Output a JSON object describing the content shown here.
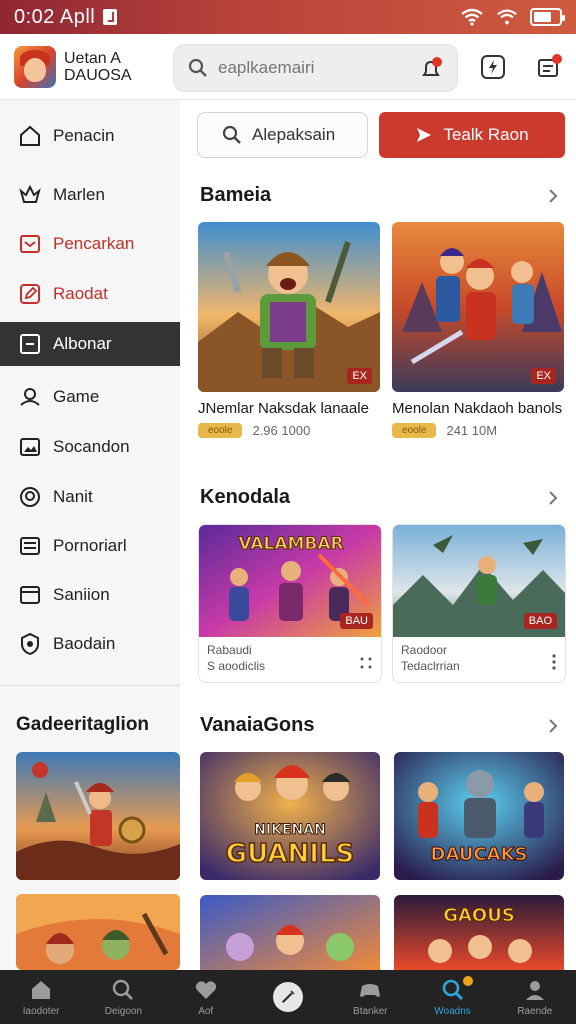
{
  "status": {
    "time": "0:02 Apll",
    "battery_level": 0.7
  },
  "header": {
    "app_name_line1": "Uetan  A",
    "app_name_line2": "DAUOSA",
    "search_placeholder": "eaplkaemairi"
  },
  "sidebar": {
    "items": [
      {
        "label": "Penacin",
        "icon": "home-icon"
      },
      {
        "label": "Marlen",
        "icon": "crown-icon"
      },
      {
        "label": "Pencarkan",
        "icon": "inbox-icon"
      },
      {
        "label": "Raodat",
        "icon": "edit-icon"
      },
      {
        "label": "Albonar",
        "icon": "square-icon"
      },
      {
        "label": "Game",
        "icon": "people-icon"
      },
      {
        "label": "Socandon",
        "icon": "image-icon"
      },
      {
        "label": "Nanit",
        "icon": "badge-icon"
      },
      {
        "label": "Pornoriarl",
        "icon": "list-icon"
      },
      {
        "label": "Saniion",
        "icon": "window-icon"
      },
      {
        "label": "Baodain",
        "icon": "shield-icon"
      }
    ],
    "section_title": "Gadeeritaglion"
  },
  "main": {
    "search_button_label": "Alepaksain",
    "cta_label": "Tealk Raon",
    "sections": [
      {
        "title": "Bameia",
        "cards": [
          {
            "title": "JNemlar Naksdak lanaale",
            "pill": "eoole",
            "meta": "2.96 1000",
            "tag": "EX"
          },
          {
            "title": "Menolan Nakdaoh banols",
            "pill": "eoole",
            "meta": "241 10M",
            "tag": "EX"
          }
        ]
      },
      {
        "title": "Kenodala",
        "cards": [
          {
            "title_line1": "Rabaudi",
            "title_line2": "S aoodiclis",
            "tag": "BAU"
          },
          {
            "title_line1": "Raodoor",
            "title_line2": "Tedaclrrian",
            "tag": "BAO"
          }
        ]
      },
      {
        "title": "VanaiaGons",
        "cards": [
          {
            "art_text_line1": "NIKENAN",
            "art_text_line2": "GUANILS"
          },
          {
            "art_text": "DAUCAKS"
          },
          {
            "art_text": ""
          },
          {
            "art_text": "GAOUS"
          }
        ]
      }
    ],
    "first_card_art_text": "VALAMBAR"
  },
  "bottom_nav": [
    {
      "label": "Iaodoter",
      "icon": "home-icon"
    },
    {
      "label": "Deigoon",
      "icon": "search-icon"
    },
    {
      "label": "Aof",
      "icon": "heart-icon"
    },
    {
      "label": "",
      "icon": "wand-icon"
    },
    {
      "label": "Btanker",
      "icon": "gamepad-icon"
    },
    {
      "label": "Woadns",
      "icon": "search-active-icon"
    },
    {
      "label": "Raende",
      "icon": "person-icon"
    }
  ],
  "colors": {
    "accent": "#cc3a2e",
    "active_nav": "#2fa6d8",
    "pill": "#e8b84a"
  }
}
